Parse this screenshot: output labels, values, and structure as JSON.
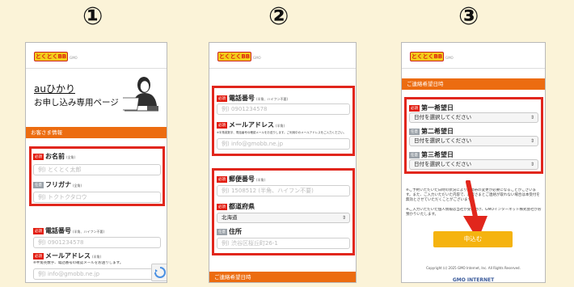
{
  "steps": [
    "①",
    "②",
    "③"
  ],
  "brand": {
    "logo_text": "とくとくBB",
    "logo_sub": "GMO"
  },
  "phone1": {
    "title_line1": "auひかり",
    "title_line2": "お申し込み専用ページ",
    "section_header": "お客さま情報",
    "name": {
      "badge": "必須",
      "label": "お名前",
      "note": "(全角)",
      "placeholder": "例) とくとく太郎"
    },
    "furigana": {
      "badge": "任意",
      "label": "フリガナ",
      "note": "(全角)",
      "placeholder": "例) トクトクタロウ"
    },
    "phone": {
      "badge": "必須",
      "label": "電話番号",
      "note": "(半角、ハイフン不要)",
      "placeholder": "例) 0901234578"
    },
    "email": {
      "badge": "必須",
      "label": "メールアドレス",
      "note": "(半角)",
      "hint": "※半角英数字、電話番号の確認メールをお送りします。",
      "placeholder": "例) info@gmobb.ne.jp"
    }
  },
  "phone2": {
    "phone": {
      "badge": "必須",
      "label": "電話番号",
      "note": "(半角、ハイフン不要)",
      "placeholder": "例) 0901234578"
    },
    "email": {
      "badge": "必須",
      "label": "メールアドレス",
      "note": "(半角)",
      "hint": "※半角英数字、電話番号の確認メールをお送りします。ご利用中のメールアドレスをご入力ください。",
      "placeholder": "例) info@gmobb.ne.jp"
    },
    "postal": {
      "badge": "必須",
      "label": "郵便番号",
      "note": "(半角)",
      "placeholder": "例) 1508512 (半角、ハイフン不要)"
    },
    "prefecture": {
      "badge": "必須",
      "label": "都道府県",
      "value": "北海道"
    },
    "address": {
      "badge": "任意",
      "label": "住所",
      "placeholder": "例) 渋谷区桜丘町26-1"
    },
    "section_header": "ご連絡希望日時"
  },
  "phone3": {
    "section_header": "ご連絡希望日時",
    "choices": [
      {
        "badge": "必須",
        "label": "第一希望日",
        "value": "日付を選択してください"
      },
      {
        "badge": "任意",
        "label": "第二希望日",
        "value": "日付を選択してください"
      },
      {
        "badge": "任意",
        "label": "第三希望日",
        "value": "日付を選択してください"
      }
    ],
    "notes": [
      "※ご予約いただいた日時の状況により時間帯の変更が必要になることがございます。また、ご入力いただいた内容で、お客さまとご連絡が取れない場合は本受付を無効とさせていただくことがございます。",
      "※ご入力いただいた個人情報は当社が受け付け、GMOインターネット株式会社がお預かりいたします。"
    ],
    "submit_label": "申込む",
    "copyright": "Copyright (c) 2025 GMO Internet, Inc. All Rights Reserved.",
    "footer_logo": "GMO INTERNET"
  },
  "colors": {
    "highlight": "#e1261c",
    "accent": "#ec6c10",
    "submit": "#f5b30f",
    "background": "#fbf3d8"
  }
}
